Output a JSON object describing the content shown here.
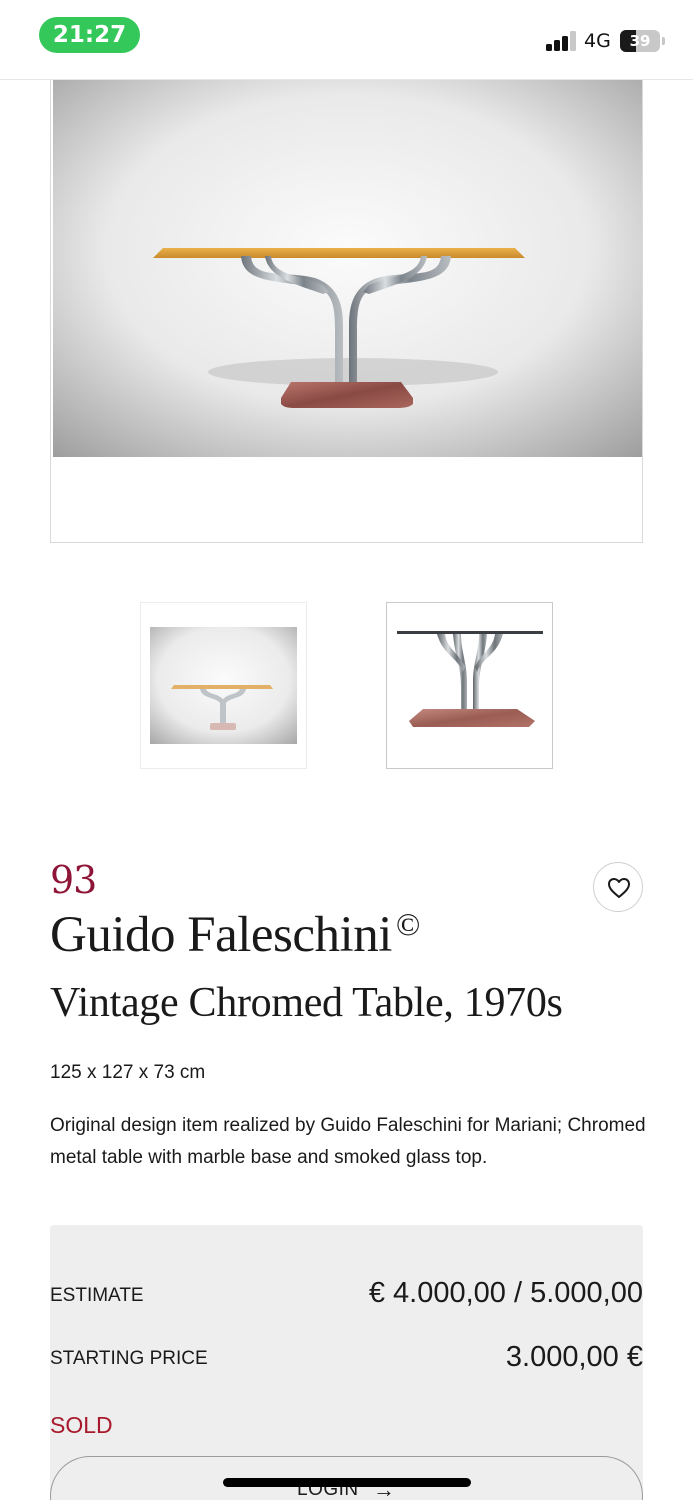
{
  "status_bar": {
    "time": "21:27",
    "network": "4G",
    "battery": "39",
    "battery_level": 0.39,
    "time_pill_color": "#34c759"
  },
  "gallery": {
    "main_image": "vintage-chromed-table-photo",
    "thumbnails": [
      "table-front-view-thumbnail",
      "table-base-detail-thumbnail"
    ],
    "selected_thumbnail": 1
  },
  "lot": {
    "number": "93",
    "artist": "Guido Faleschini",
    "copyright_mark": "©",
    "title": "Vintage Chromed Table, 1970s",
    "dimensions": "125 x 127 x 73 cm",
    "description": "Original design item realized by Guido Faleschini for Mariani; Chromed metal table with marble base and smoked glass top.",
    "accent_color": "#8e1538"
  },
  "pricing": {
    "estimate_label": "ESTIMATE",
    "estimate_value": "€ 4.000,00 / 5.000,00",
    "starting_label": "STARTING PRICE",
    "starting_value": "3.000,00 €",
    "status": "SOLD",
    "status_color": "#a8192b",
    "login_label": "LOGIN",
    "login_arrow": "→"
  },
  "icons": {
    "favorite": "heart-outline-icon",
    "signal": "cellular-signal-icon",
    "battery": "battery-icon"
  }
}
